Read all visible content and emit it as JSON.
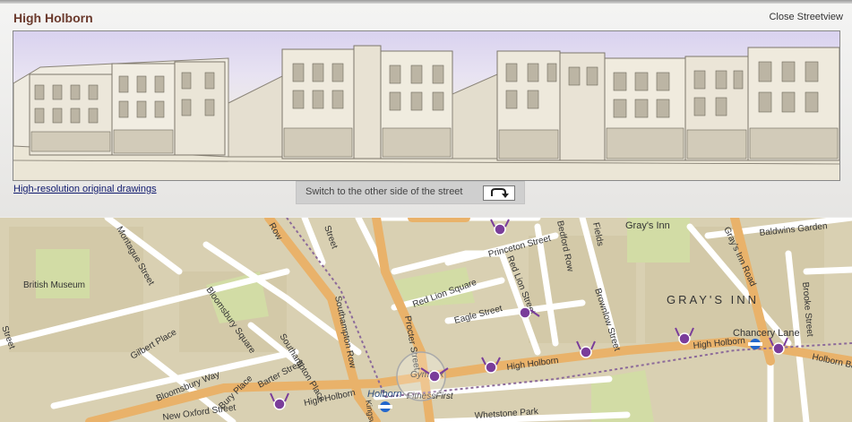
{
  "header": {
    "title": "High Holborn",
    "close_label": "Close Streetview"
  },
  "streetview": {
    "hires_link": "High-resolution original drawings",
    "switch_label": "Switch to the other side of the street"
  },
  "map": {
    "labels": {
      "british_museum": "British Museum",
      "montague": "Montague Street",
      "bloomsbury_sq": "Bloomsbury Square",
      "southampton_place": "Southampton Place",
      "southampton_row": "Southampton Row",
      "gilbert": "Gilbert Place",
      "barter": "Barter Street",
      "bloomsbury_way": "Bloomsbury Way",
      "bury_place": "Bury Place",
      "new_oxford": "New Oxford Street",
      "high_holborn_w": "High Holborn",
      "high_holborn_c": "High Holborn",
      "high_holborn_e": "High Holborn",
      "holborn_bar": "Holborn Bar",
      "holborn_station": "Holborn",
      "fitness_first": "FitnessFirst",
      "gymbox": "Gymbox",
      "princeton": "Princeton Street",
      "red_lion_sq": "Red Lion Square",
      "red_lion_st": "Red Lion Street",
      "eagle": "Eagle Street",
      "procter": "Procter Street",
      "bedford_row": "Bedford Row",
      "fields": "Fields",
      "brownlow": "Brownlow Street",
      "grays_inn": "Gray's Inn",
      "grays_inn_road": "Gray's Inn Road",
      "grays_inn_block": "GRAY'S INN",
      "baldwins": "Baldwins Garden",
      "brooke": "Brooke Street",
      "chancery": "Chancery Lane",
      "whetstone": "Whetstone Park",
      "kingsway": "Kingsway",
      "street_left": "Street",
      "street_top": "Street",
      "row_top": "Row"
    }
  },
  "colors": {
    "title": "#6b3a2d",
    "road_major": "#e9b26a",
    "road_minor": "#ffffff",
    "marker": "#7a3d9a",
    "park": "#d2dca5"
  }
}
